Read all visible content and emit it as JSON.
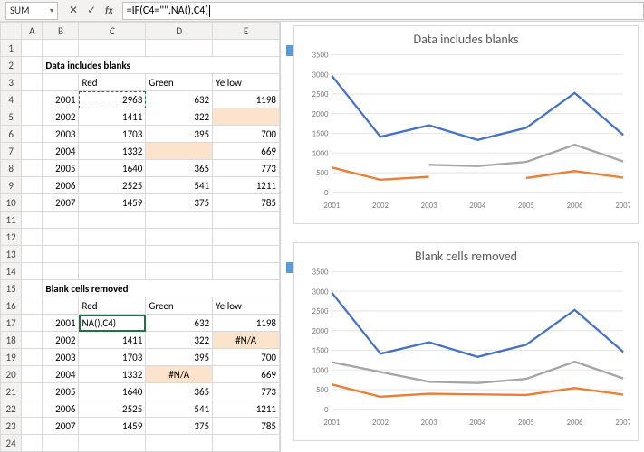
{
  "formula_bar": {
    "name_box": "SUM",
    "cancel": "✕",
    "confirm": "✓",
    "fx": "fx",
    "formula": "=IF(C4=\"\",NA(),C4)"
  },
  "columns": [
    "",
    "A",
    "B",
    "C",
    "D",
    "E"
  ],
  "table1": {
    "title": "Data includes blanks",
    "headers": {
      "c": "Red",
      "d": "Green",
      "e": "Yellow"
    }
  },
  "table2": {
    "title": "Blank cells removed",
    "headers": {
      "c": "Red",
      "d": "Green",
      "e": "Yellow"
    },
    "c17_display": "NA(),C4)"
  },
  "years": [
    "2001",
    "2002",
    "2003",
    "2004",
    "2005",
    "2006",
    "2007"
  ],
  "data1": {
    "red": [
      2963,
      1411,
      1703,
      1332,
      1640,
      2525,
      1459
    ],
    "green": [
      632,
      322,
      395,
      null,
      365,
      541,
      375
    ],
    "yellow": [
      1198,
      null,
      700,
      669,
      773,
      1211,
      785
    ]
  },
  "data2": {
    "red": [
      "NA(),C4)",
      "1411",
      "1703",
      "1332",
      "1640",
      "2525",
      "1459"
    ],
    "green": [
      "632",
      "322",
      "395",
      "#N/A",
      "365",
      "541",
      "375"
    ],
    "yellow": [
      "1198",
      "#N/A",
      "700",
      "669",
      "773",
      "1211",
      "785"
    ]
  },
  "chart_data": [
    {
      "type": "line",
      "title": "Data includes blanks",
      "categories": [
        "2001",
        "2002",
        "2003",
        "2004",
        "2005",
        "2006",
        "2007"
      ],
      "ylim": [
        0,
        3500
      ],
      "yticks": [
        0,
        500,
        1000,
        1500,
        2000,
        2500,
        3000,
        3500
      ],
      "series": [
        {
          "name": "Red",
          "color": "#4472C4",
          "values": [
            2963,
            1411,
            1703,
            1332,
            1640,
            2525,
            1459
          ]
        },
        {
          "name": "Green",
          "color": "#ED7D31",
          "values": [
            632,
            322,
            395,
            null,
            365,
            541,
            375
          ]
        },
        {
          "name": "Yellow",
          "color": "#A5A5A5",
          "values": [
            1198,
            null,
            700,
            669,
            773,
            1211,
            785
          ]
        }
      ]
    },
    {
      "type": "line",
      "title": "Blank cells removed",
      "categories": [
        "2001",
        "2002",
        "2003",
        "2004",
        "2005",
        "2006",
        "2007"
      ],
      "ylim": [
        0,
        3500
      ],
      "yticks": [
        0,
        500,
        1000,
        1500,
        2000,
        2500,
        3000,
        3500
      ],
      "series": [
        {
          "name": "Red",
          "color": "#4472C4",
          "values": [
            2963,
            1411,
            1703,
            1332,
            1640,
            2525,
            1459
          ]
        },
        {
          "name": "Green",
          "color": "#ED7D31",
          "values": [
            632,
            322,
            395,
            null,
            365,
            541,
            375
          ],
          "connect_na": true
        },
        {
          "name": "Yellow",
          "color": "#A5A5A5",
          "values": [
            1198,
            null,
            700,
            669,
            773,
            1211,
            785
          ],
          "connect_na": true
        }
      ]
    }
  ]
}
